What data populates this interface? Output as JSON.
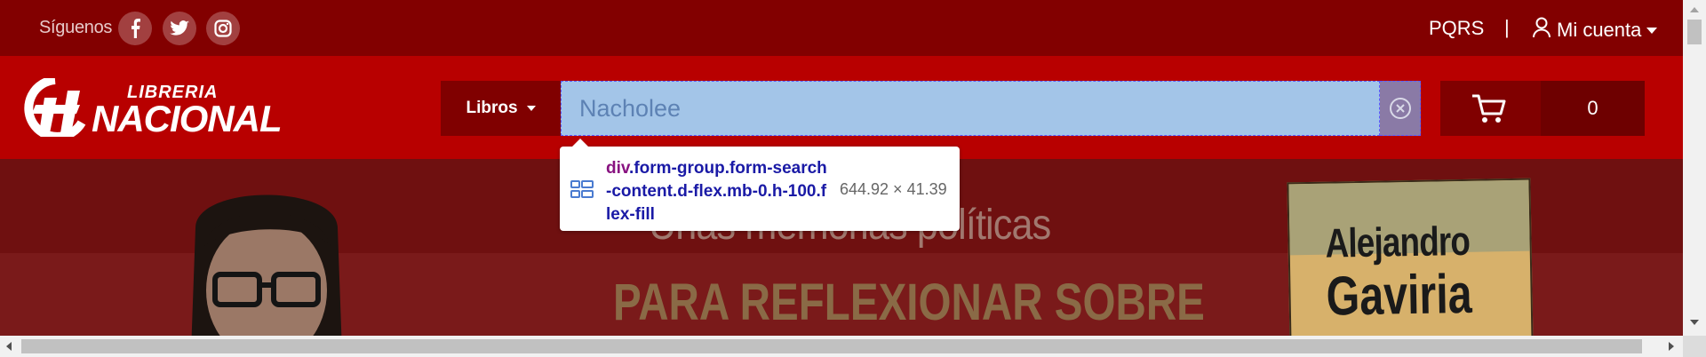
{
  "topbar": {
    "follow_label": "Síguenos",
    "social": [
      "facebook-icon",
      "twitter-icon",
      "instagram-icon"
    ],
    "pqrs_label": "PQRS",
    "separator": "|",
    "account_label": "Mi cuenta"
  },
  "header": {
    "logo_top": "LIBRERIA",
    "logo_main": "NACIONAL",
    "category_label": "Libros",
    "search_value": "Nacholee",
    "cart_count": "0"
  },
  "banner": {
    "subtitle": "Unas memorias políticas",
    "headline": "PARA REFLEXIONAR SOBRE",
    "book_author_first": "Alejandro",
    "book_author_last": "Gaviria"
  },
  "devtools_tooltip": {
    "tag": "div",
    "classes": ".form-group.form-search-content.d-flex.mb-0.h-100.flex-fill",
    "size": "644.92 × 41.39"
  },
  "colors": {
    "topbar_bg": "#820000",
    "header_bg": "#b80000",
    "search_highlight": "#a3c5e8"
  }
}
